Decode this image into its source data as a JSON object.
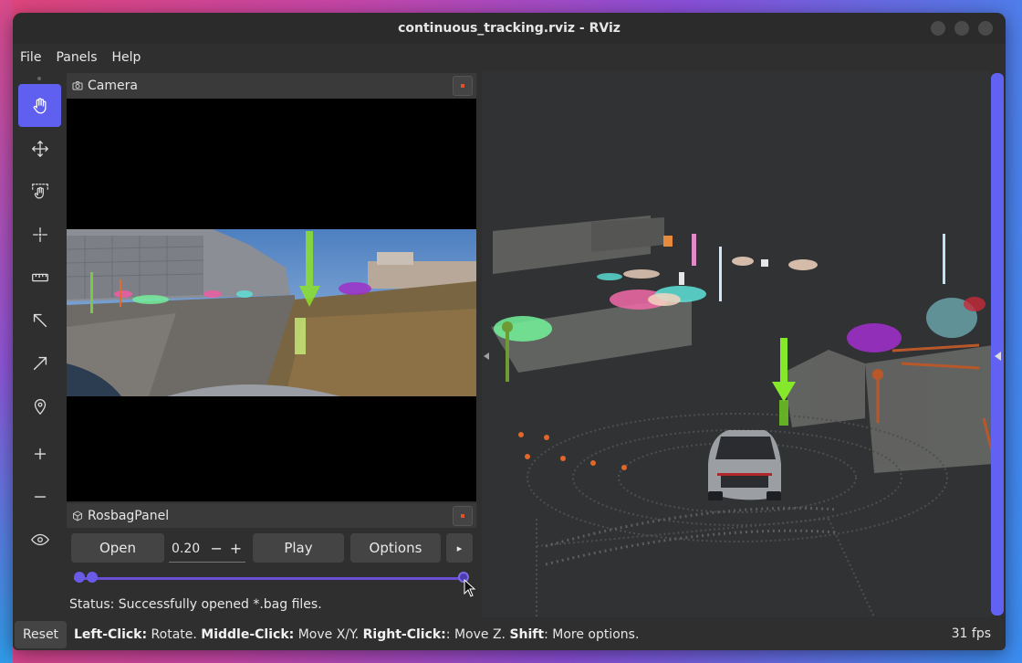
{
  "window": {
    "title": "continuous_tracking.rviz - RViz"
  },
  "menu": {
    "items": [
      "File",
      "Panels",
      "Help"
    ]
  },
  "toolbar": {
    "tools": [
      {
        "name": "interact-tool",
        "icon": "hand-icon",
        "active": true
      },
      {
        "name": "move-camera-tool",
        "icon": "move-arrows-icon",
        "active": false
      },
      {
        "name": "select-tool",
        "icon": "select-hand-icon",
        "active": false
      },
      {
        "name": "focus-camera-tool",
        "icon": "crosshair-icon",
        "active": false
      },
      {
        "name": "measure-tool",
        "icon": "ruler-icon",
        "active": false
      },
      {
        "name": "pose-estimate-tool",
        "icon": "arrow-up-left-icon",
        "active": false
      },
      {
        "name": "nav-goal-tool",
        "icon": "arrow-up-right-icon",
        "active": false
      },
      {
        "name": "publish-point-tool",
        "icon": "map-pin-icon",
        "active": false
      },
      {
        "name": "add-tool",
        "icon": "plus-icon",
        "active": false
      },
      {
        "name": "remove-tool",
        "icon": "minus-icon",
        "active": false
      },
      {
        "name": "visibility-tool",
        "icon": "eye-icon",
        "active": false
      }
    ]
  },
  "camera_panel": {
    "title": "Camera"
  },
  "rosbag_panel": {
    "title": "RosbagPanel",
    "open_label": "Open",
    "speed_value": "0.20",
    "minus_label": "−",
    "plus_label": "+",
    "play_label": "Play",
    "options_label": "Options",
    "expand_label": "▸",
    "status": "Status: Successfully opened *.bag files."
  },
  "bottom": {
    "reset_label": "Reset",
    "help": [
      {
        "key": "Left-Click:",
        "text": " Rotate. "
      },
      {
        "key": "Middle-Click:",
        "text": " Move X/Y. "
      },
      {
        "key": "Right-Click:",
        "text": ": Move Z. "
      },
      {
        "key": "Shift",
        "text": ": More options."
      }
    ],
    "fps": "31 fps"
  },
  "colors": {
    "accent": "#5f5ff0",
    "window_bg": "#2f2f2f",
    "viewport_bg": "#303234",
    "close_dot": "#e0522c"
  }
}
